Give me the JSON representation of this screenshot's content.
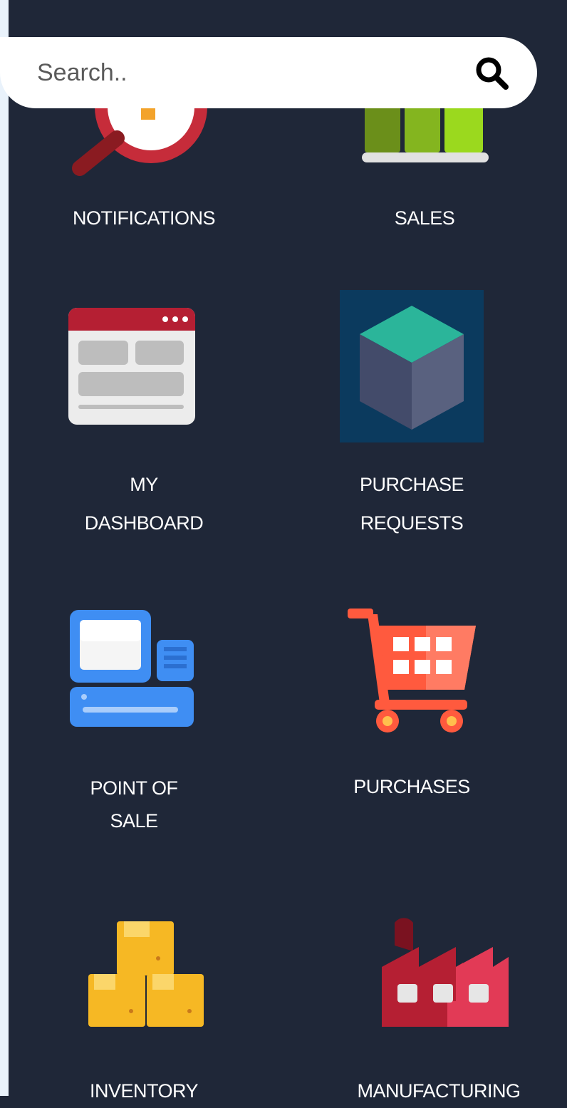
{
  "search": {
    "placeholder": "Search.."
  },
  "apps": {
    "notifications": {
      "label": "NOTIFICATIONS"
    },
    "sales": {
      "label": "SALES"
    },
    "my_dashboard": {
      "line1": "MY",
      "line2": "DASHBOARD"
    },
    "purchase_requests": {
      "line1": "PURCHASE",
      "line2": "REQUESTS"
    },
    "point_of_sale": {
      "line1": "POINT OF",
      "line2": "SALE"
    },
    "purchases": {
      "label": "PURCHASES"
    },
    "inventory": {
      "label": "INVENTORY"
    },
    "manufacturing": {
      "label": "MANUFACTURING"
    }
  },
  "colors": {
    "background": "#1f2738",
    "label_text": "#ffffff",
    "search_bg": "#ffffff"
  }
}
